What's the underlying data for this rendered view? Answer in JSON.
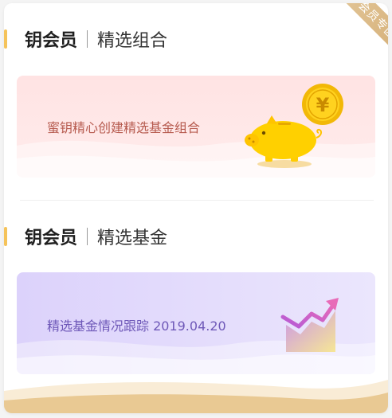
{
  "ribbon": {
    "label": "会员专区"
  },
  "sections": [
    {
      "brand": "钥会员",
      "topic": "精选组合",
      "banner": {
        "text": "蜜钥精心创建精选基金组合",
        "illustration": "piggy-bank-coin-icon"
      }
    },
    {
      "brand": "钥会员",
      "topic": "精选基金",
      "banner": {
        "text": "精选基金情况跟踪  2019.04.20",
        "illustration": "trend-chart-icon"
      }
    }
  ],
  "colors": {
    "accent": "#f5c35a",
    "ribbon": "#d9b57f",
    "pink_banner": "#ffe5e5",
    "purple_banner": "#e2d9fc",
    "pink_text": "#b65a4e",
    "purple_text": "#6e58b8"
  }
}
